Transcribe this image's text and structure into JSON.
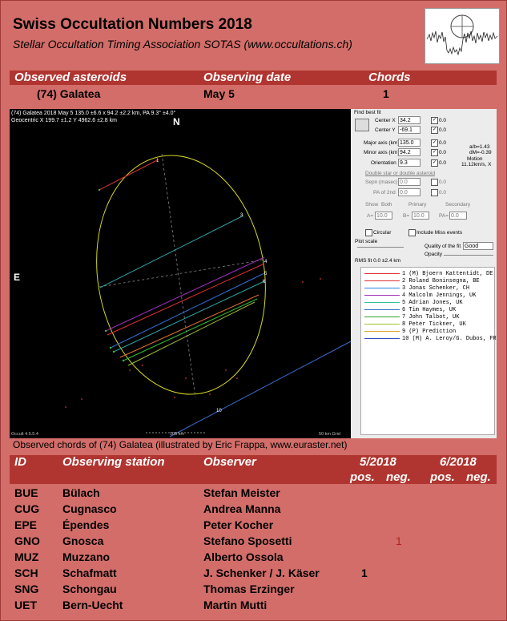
{
  "header": {
    "title": "Swiss Occultation Numbers 2018",
    "subtitle": "Stellar Occultation Timing Association SOTAS (www.occultations.ch)"
  },
  "summary": {
    "col_asteroid": "Observed asteroids",
    "col_date": "Observing date",
    "col_chords": "Chords",
    "asteroid": "(74) Galatea",
    "date": "May 5",
    "chords": "1"
  },
  "plot": {
    "info_line1": "(74) Galatea  2018 May 5  135.0 ±6.6 x 94.2 ±2.2 km, PA 9.3° ±4.0°",
    "info_line2": "Geocentric X  199.7 ±1.2  Y 4962.6 ±2.8 km",
    "north": "N",
    "east": "E",
    "version": "Occult 4.5.5.4",
    "scale_bar": "100 km",
    "grid": "50 km Grid",
    "line10_label": "10",
    "chord_numbers": [
      "1",
      "2",
      "3",
      "4",
      "5",
      "6",
      "7",
      "8"
    ]
  },
  "fit_panel": {
    "title": "Find best fit",
    "center_x_label": "Center X",
    "center_x": "34.2",
    "center_y_label": "Center Y",
    "center_y": "-69.1",
    "major_label": "Major axis (km)",
    "major": "135.0",
    "minor_label": "Minor axis (km)",
    "minor": "94.2",
    "orient_label": "Orientation",
    "orient": "9.3",
    "zero": "0.0",
    "ab": "a/b=1.43",
    "dm": "dM=-0.39",
    "motion_label": "Motion",
    "motion": "11.12km/s, X",
    "double_star": "Double star  or  double asteroid",
    "sepn_label": "Sepn (masec)",
    "pa2_label": "PA of 2nd",
    "show_label": "Show",
    "show_both": "Both",
    "show_primary": "Primary",
    "show_secondary": "Secondary",
    "a_label": "A=",
    "b_label": "B=",
    "pa_label": "PA=",
    "ten": "10.0",
    "circular": "Circular",
    "include_miss": "Include Miss events",
    "plot_scale": "Plot scale",
    "quality_label": "Quality of the fit",
    "quality": "Good",
    "opacity_label": "Opacity",
    "rms": "RMS fit 0.0 ±2.4 km"
  },
  "observers_legend": [
    {
      "text": "1 (M)  Bjoern Kattentidt, DE",
      "color": "#e03030"
    },
    {
      "text": "2      Roland Boninsegna, BE",
      "color": "#e03030"
    },
    {
      "text": "3      Jonas Schenker, CH",
      "color": "#3080e0"
    },
    {
      "text": "4      Malcolm Jennings, UK",
      "color": "#a030c0"
    },
    {
      "text": "5      Adrian Jones, UK",
      "color": "#30c0a0"
    },
    {
      "text": "6      Tim Haymes, UK",
      "color": "#3070d0"
    },
    {
      "text": "7      John Talbot, UK",
      "color": "#30a030"
    },
    {
      "text": "8      Peter Tickner, UK",
      "color": "#a0c030"
    },
    {
      "text": "9 (P)  Prediction",
      "color": "#e0a030"
    },
    {
      "text": "10 (M) A. Leroy/G. Dubos, FR",
      "color": "#3050c0"
    }
  ],
  "caption": "Observed chords of (74) Galatea (illustrated by Eric Frappa, www.euraster.net)",
  "stations_header": {
    "id": "ID",
    "station": "Observing station",
    "observer": "Observer",
    "month1": "5/2018",
    "month2": "6/2018",
    "pos": "pos.",
    "neg": "neg."
  },
  "stations": [
    {
      "id": "BUE",
      "station": "Bülach",
      "observer": "Stefan Meister",
      "pos5": "",
      "neg5": "",
      "pos6": "",
      "neg6": ""
    },
    {
      "id": "CUG",
      "station": "Cugnasco",
      "observer": "Andrea Manna",
      "pos5": "",
      "neg5": "",
      "pos6": "",
      "neg6": ""
    },
    {
      "id": "EPE",
      "station": "Épendes",
      "observer": "Peter Kocher",
      "pos5": "",
      "neg5": "",
      "pos6": "",
      "neg6": ""
    },
    {
      "id": "GNO",
      "station": "Gnosca",
      "observer": "Stefano Sposetti",
      "pos5": "",
      "neg5": "1",
      "pos6": "",
      "neg6": ""
    },
    {
      "id": "MUZ",
      "station": "Muzzano",
      "observer": "Alberto Ossola",
      "pos5": "",
      "neg5": "",
      "pos6": "",
      "neg6": ""
    },
    {
      "id": "SCH",
      "station": "Schafmatt",
      "observer": "J. Schenker / J. Käser",
      "pos5": "1",
      "neg5": "",
      "pos6": "",
      "neg6": ""
    },
    {
      "id": "SNG",
      "station": "Schongau",
      "observer": "Thomas Erzinger",
      "pos5": "",
      "neg5": "",
      "pos6": "",
      "neg6": ""
    },
    {
      "id": "UET",
      "station": "Bern-Uecht",
      "observer": "Martin Mutti",
      "pos5": "",
      "neg5": "",
      "pos6": "",
      "neg6": ""
    }
  ]
}
